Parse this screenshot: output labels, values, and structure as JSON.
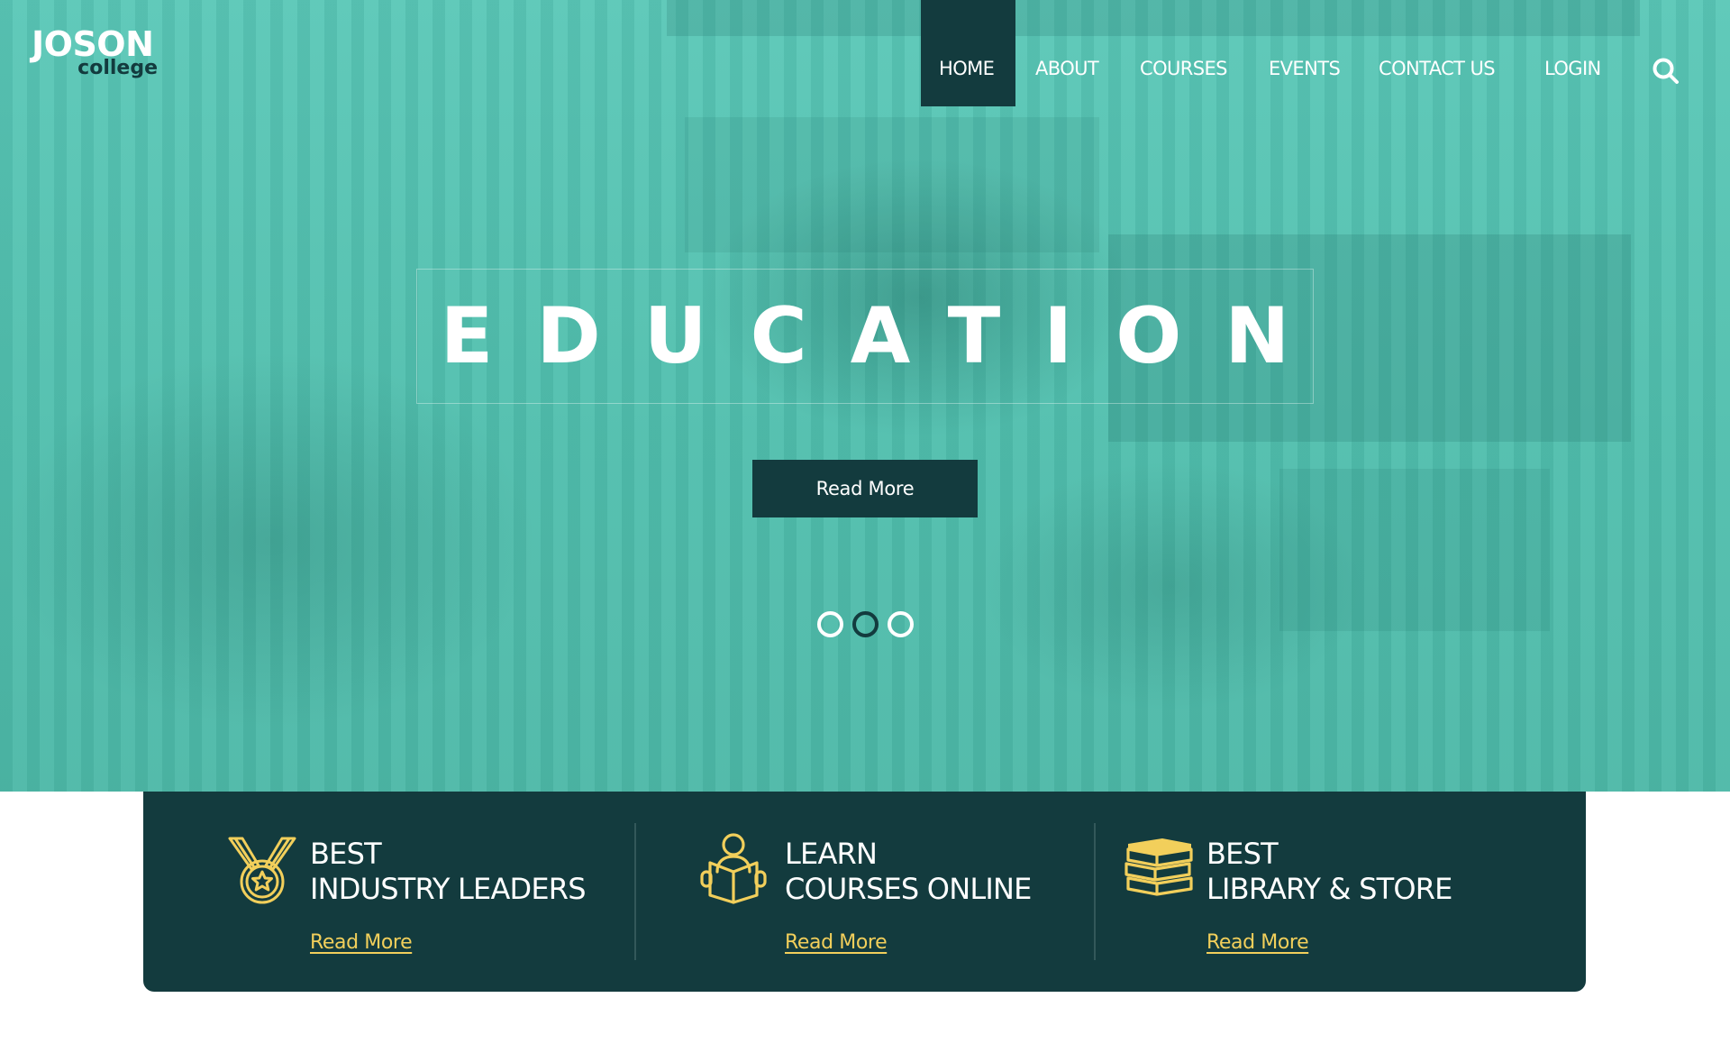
{
  "brand": {
    "name": "JOSON",
    "subtitle": "college"
  },
  "nav": {
    "items": [
      {
        "label": "HOME",
        "active": true
      },
      {
        "label": "ABOUT",
        "active": false
      },
      {
        "label": "COURSES",
        "active": false
      },
      {
        "label": "EVENTS",
        "active": false
      },
      {
        "label": "CONTACT US",
        "active": false
      },
      {
        "label": "LOGIN",
        "active": false
      }
    ],
    "search_icon": "search-icon"
  },
  "hero": {
    "title": "EDUCATION",
    "button_label": "Read More",
    "slides": 3,
    "active_slide": 2
  },
  "features": [
    {
      "icon": "medal-icon",
      "line1": "BEST",
      "line2": "INDUSTRY LEADERS",
      "link": "Read More"
    },
    {
      "icon": "reading-person-icon",
      "line1": "LEARN",
      "line2": "COURSES ONLINE",
      "link": "Read More"
    },
    {
      "icon": "books-stack-icon",
      "line1": "BEST",
      "line2": "LIBRARY & STORE",
      "link": "Read More"
    }
  ],
  "colors": {
    "primary_dark": "#133b3e",
    "hero_teal": "#5cc8b8",
    "accent_gold": "#f2cf5b",
    "white": "#ffffff"
  }
}
